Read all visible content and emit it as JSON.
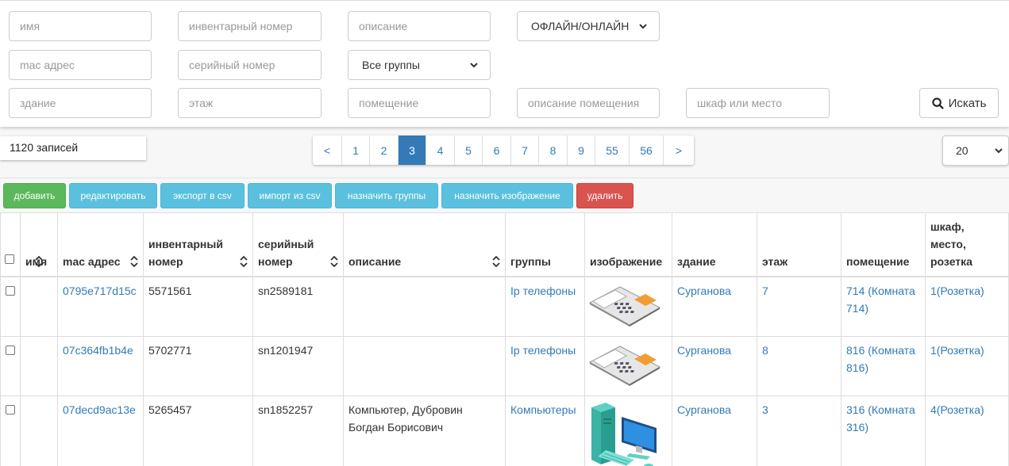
{
  "filters": {
    "name_placeholder": "имя",
    "inventory_placeholder": "инвентарный номер",
    "description_placeholder": "описание",
    "status_select": "ОФЛАЙН/ОНЛАЙН",
    "mac_placeholder": "mac адрес",
    "serial_placeholder": "серийный номер",
    "groups_select": "Все группы",
    "building_placeholder": "здание",
    "floor_placeholder": "этаж",
    "room_placeholder": "помещение",
    "room_desc_placeholder": "описание помещения",
    "cabinet_placeholder": "шкаф или место",
    "search_label": "Искать"
  },
  "records_count": "1120 записей",
  "pagination": {
    "prev": "<",
    "pages": [
      "1",
      "2",
      "3",
      "4",
      "5",
      "6",
      "7",
      "8",
      "9",
      "55",
      "56"
    ],
    "active": "3",
    "next": ">"
  },
  "per_page": "20",
  "actions": {
    "add": "добавить",
    "edit": "редактировать",
    "export": "экспорт в csv",
    "import": "импорт из csv",
    "assign_groups": "назначить группы",
    "assign_image": "назначить изображение",
    "delete": "удалить"
  },
  "table": {
    "headers": {
      "name": "имя",
      "mac": "mac адрес",
      "inventory": "инвентарный номер",
      "serial": "серийный номер",
      "description": "описание",
      "groups": "группы",
      "image": "изображение",
      "building": "здание",
      "floor": "этаж",
      "room": "помещение",
      "cabinet": "шкаф, место, розетка"
    },
    "rows": [
      {
        "name": "",
        "mac": "0795e717d15c",
        "inventory": "5571561",
        "serial": "sn2589181",
        "description": "",
        "groups": "Ip телефоны",
        "image": "phone-image",
        "building": "Сурганова",
        "floor": "7",
        "room": "714 (Комната 714)",
        "cabinet": "1(Розетка)"
      },
      {
        "name": "",
        "mac": "07c364fb1b4e",
        "inventory": "5702771",
        "serial": "sn1201947",
        "description": "",
        "groups": "Ip телефоны",
        "image": "phone-image",
        "building": "Сурганова",
        "floor": "8",
        "room": "816 (Комната 816)",
        "cabinet": "1(Розетка)"
      },
      {
        "name": "",
        "mac": "07decd9ac13e",
        "inventory": "5265457",
        "serial": "sn1852257",
        "description": "Компьютер, Дубровин Богдан Борисович",
        "groups": "Компьютеры",
        "image": "computer-image",
        "building": "Сурганова",
        "floor": "3",
        "room": "316 (Комната 316)",
        "cabinet": "4(Розетка)"
      }
    ]
  },
  "colors": {
    "primary": "#337ab7",
    "success": "#5cb85c",
    "info": "#5bc0de",
    "danger": "#d9534f"
  }
}
